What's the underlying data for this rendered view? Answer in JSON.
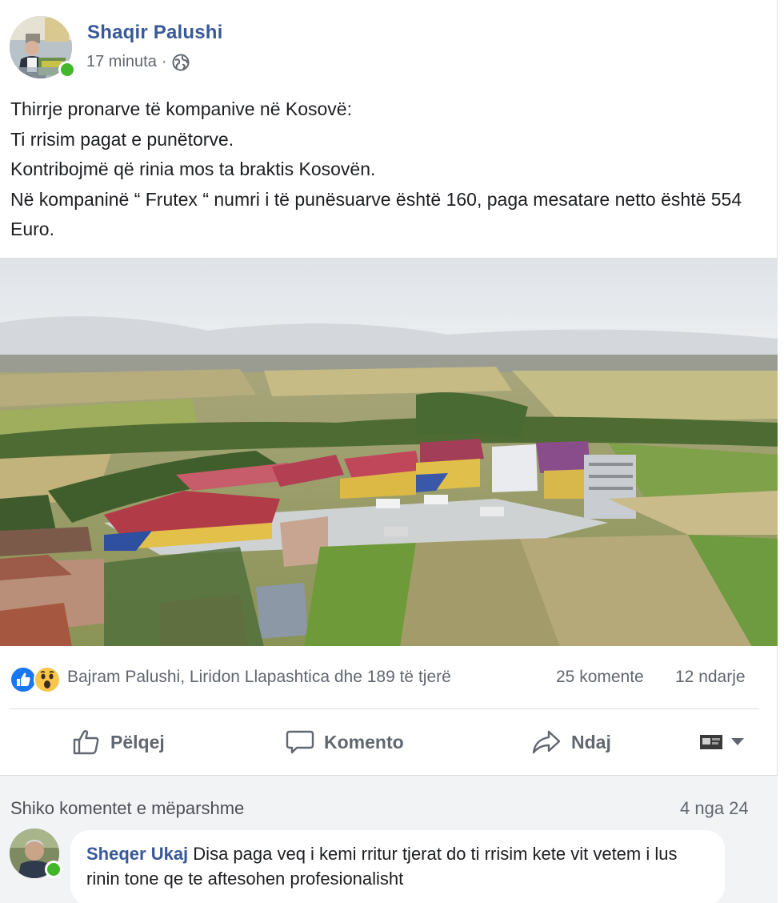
{
  "post": {
    "author": "Shaqir Palushi",
    "time": "17 minuta",
    "separator": "·",
    "privacy_icon": "globe-icon",
    "text_lines": [
      "Thirrje pronarve të kompanive në Kosovë:",
      "Ti rrisim pagat e punëtorve.",
      "Kontribojmë që rinia mos ta braktis Kosovën.",
      "Në kompaninë “ Frutex “ numri i të punësuarve është 160, paga mesatare netto është 554 Euro."
    ]
  },
  "reactions": {
    "icons": [
      "like-reaction-icon",
      "wow-reaction-icon"
    ],
    "names": "Bajram Palushi, Liridon Llapashtica dhe 189 të tjerë",
    "comments": "25 komente",
    "shares": "12 ndarje"
  },
  "actions": {
    "like": "Pëlqej",
    "comment": "Komento",
    "share": "Ndaj"
  },
  "comments": {
    "view_previous": "Shiko komentet e mëparshme",
    "pagination": "4 nga 24",
    "items": [
      {
        "author": "Sheqer Ukaj",
        "text": "Disa paga veq i kemi rritur tjerat do ti rrisim kete vit vetem i lus rinin tone qe te aftesohen profesionalisht"
      }
    ]
  },
  "colors": {
    "link_blue": "#385898",
    "meta_gray": "#606770",
    "online_green": "#42b72a",
    "like_blue": "#1877f2",
    "wow_yellow": "#f7c64b"
  }
}
